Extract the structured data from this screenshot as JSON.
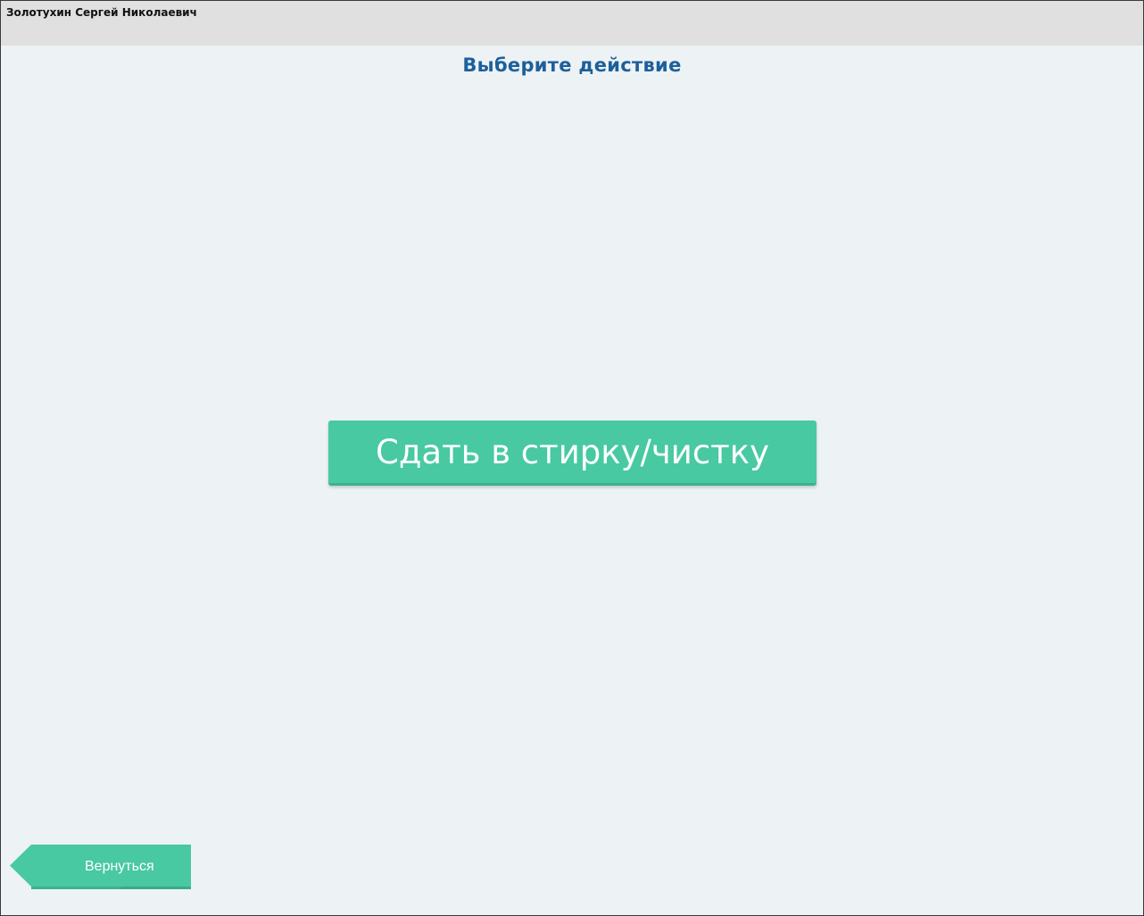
{
  "header": {
    "user_name": "Золотухин Сергей Николаевич"
  },
  "main": {
    "title": "Выберите действие",
    "action_label": "Сдать в стирку/чистку"
  },
  "footer": {
    "back_label": "Вернуться",
    "back_icon": "arrow-left-shape-icon"
  },
  "colors": {
    "accent": "#48c9a1",
    "title": "#1d5f9b",
    "header_bg": "#e0e0e0",
    "page_bg": "#edf2f5"
  }
}
